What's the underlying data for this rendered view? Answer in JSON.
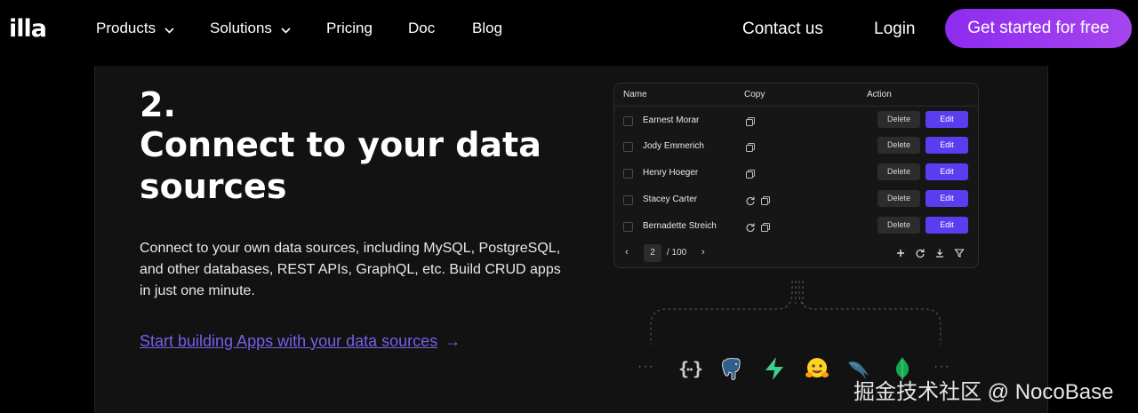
{
  "nav": {
    "logo": "illa",
    "items": [
      {
        "label": "Products",
        "has_dropdown": true
      },
      {
        "label": "Solutions",
        "has_dropdown": true
      },
      {
        "label": "Pricing",
        "has_dropdown": false
      },
      {
        "label": "Doc",
        "has_dropdown": false
      },
      {
        "label": "Blog",
        "has_dropdown": false
      }
    ],
    "contact": "Contact us",
    "login": "Login",
    "cta": "Get started for free"
  },
  "section": {
    "step": "2.",
    "headline": "Connect to your data sources",
    "description": "Connect to your own data sources, including MySQL, PostgreSQL, and other databases, REST APIs, GraphQL, etc. Build CRUD apps in just one minute.",
    "link": "Start building Apps with your data sources",
    "link_arrow": "→"
  },
  "table": {
    "columns": [
      "Name",
      "Copy",
      "Action"
    ],
    "rows": [
      {
        "name": "Earnest Morar",
        "refresh": false
      },
      {
        "name": "Jody Emmerich",
        "refresh": false
      },
      {
        "name": "Henry Hoeger",
        "refresh": false
      },
      {
        "name": "Stacey Carter",
        "refresh": true
      },
      {
        "name": "Bernadette Streich",
        "refresh": true
      }
    ],
    "delete_label": "Delete",
    "edit_label": "Edit",
    "pagination": {
      "current": "2",
      "total": "/ 100"
    }
  },
  "data_sources": [
    "rest-api-icon",
    "postgresql-icon",
    "supabase-icon",
    "huggingface-icon",
    "mysql-icon",
    "mongodb-icon"
  ],
  "watermark": "掘金技术社区 @ NocoBase",
  "colors": {
    "accent": "#7a5ee8",
    "edit_button": "#5b3df0",
    "cta_start": "#8e2bf0",
    "cta_end": "#a545ef"
  }
}
